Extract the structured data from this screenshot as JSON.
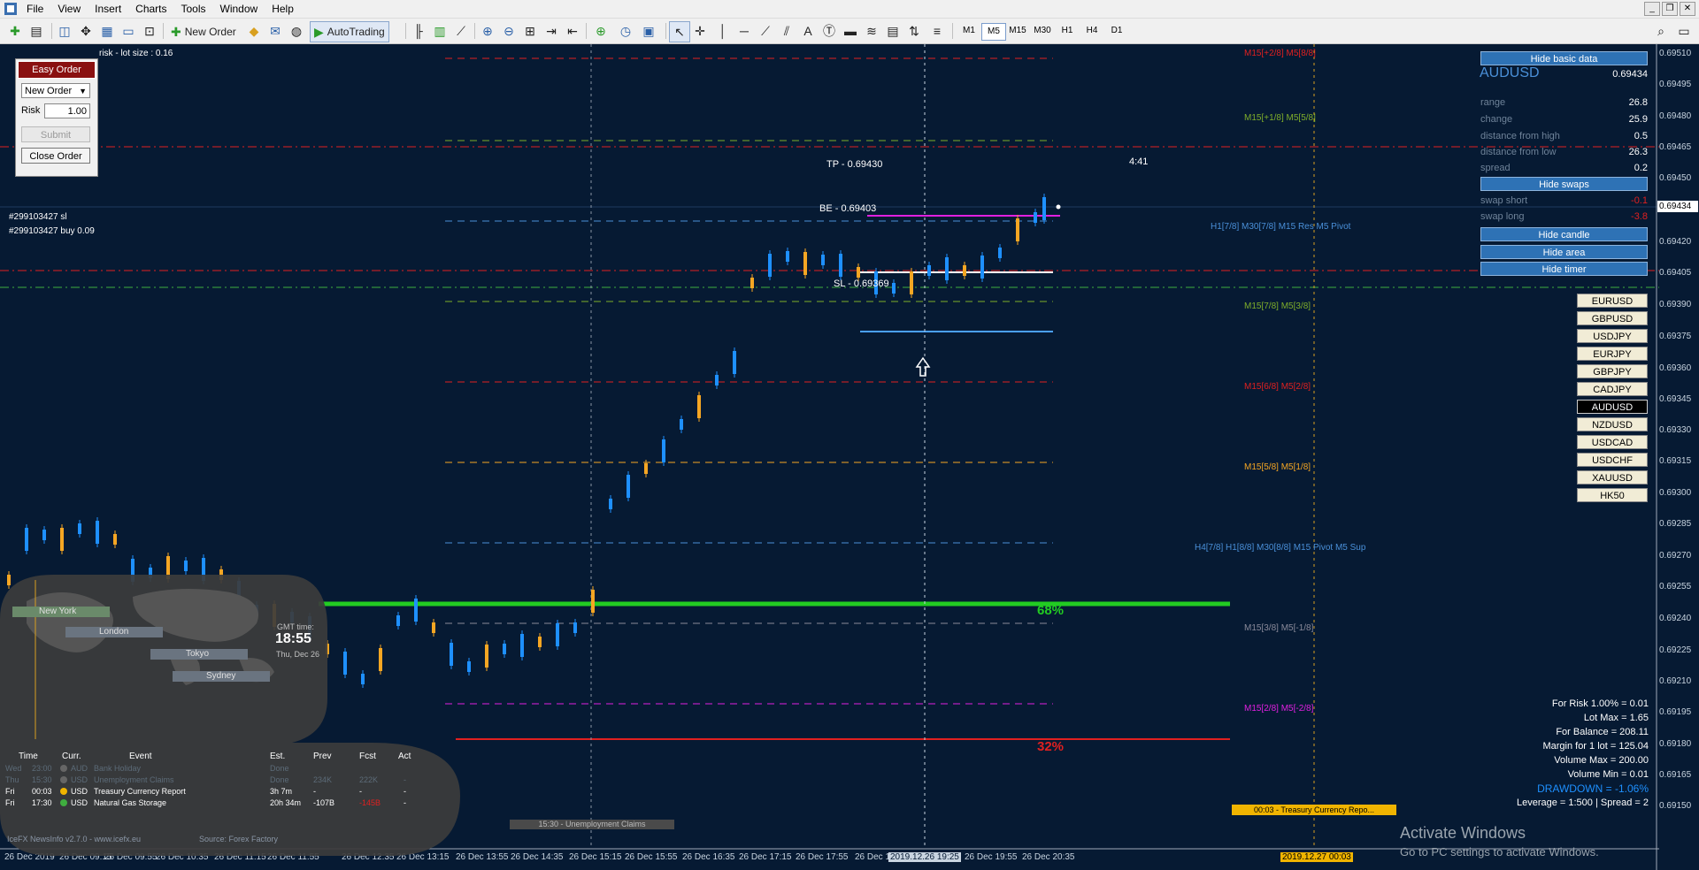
{
  "menubar": {
    "items": [
      "File",
      "View",
      "Insert",
      "Charts",
      "Tools",
      "Window",
      "Help"
    ]
  },
  "toolbar": {
    "new_order": "New Order",
    "autotrading": "AutoTrading",
    "timeframes": [
      "M1",
      "M5",
      "M15",
      "M30",
      "H1",
      "H4",
      "D1"
    ],
    "active_timeframe": "M5"
  },
  "easy_order": {
    "title": "Easy Order",
    "order_type": "New Order",
    "risk_label": "Risk",
    "risk_value": "1.00",
    "submit": "Submit",
    "close": "Close Order",
    "risk_info": "risk - lot size : 0.16"
  },
  "trade": {
    "sl_tag": "#299103427 sl",
    "buy_tag": "#299103427 buy 0.09",
    "tp": "TP - 0.69430",
    "be": "BE - 0.69403",
    "sl": "SL - 0.69369",
    "countdown": "4:41"
  },
  "levels": {
    "m15_p28": "M15[+2/8]  M5[8/8]",
    "m15_p18": "M15[+1/8]  M5[5/8]",
    "h1_res": "H1[7/8] M30[7/8] M15 Res   M5 Pivot",
    "m15_78": "M15[7/8]  M5[3/8]",
    "m15_68": "M15[6/8]  M5[2/8]",
    "m15_58": "M15[5/8]  M5[1/8]",
    "h4_sup": "H4[7/8] H1[8/8] M30[8/8] M15 Pivot   M5 Sup",
    "m15_38": "M15[3/8]  M5[-1/8]",
    "m15_28": "M15[2/8]  M5[-2/8]",
    "pct_68": "68%",
    "pct_32": "32%"
  },
  "basic_data": {
    "hide_basic": "Hide basic data",
    "symbol": "AUDUSD",
    "price": "0.69434",
    "stats": [
      {
        "label": "range",
        "value": "26.8"
      },
      {
        "label": "change",
        "value": "25.9"
      },
      {
        "label": "distance from high",
        "value": "0.5"
      },
      {
        "label": "distance from low",
        "value": "26.3"
      },
      {
        "label": "spread",
        "value": "0.2"
      }
    ],
    "hide_swaps": "Hide swaps",
    "swaps": [
      {
        "label": "swap short",
        "value": "-0.1"
      },
      {
        "label": "swap long",
        "value": "-3.8"
      }
    ],
    "hide_candle": "Hide candle",
    "hide_area": "Hide area",
    "hide_timer": "Hide timer"
  },
  "symbols": [
    "EURUSD",
    "GBPUSD",
    "USDJPY",
    "EURJPY",
    "GBPJPY",
    "CADJPY",
    "AUDUSD",
    "NZDUSD",
    "USDCAD",
    "USDCHF",
    "XAUUSD",
    "HK50"
  ],
  "active_symbol": "AUDUSD",
  "risk_info": [
    "For Risk 1.00% = 0.01",
    "Lot Max = 1.65",
    "For Balance = 208.11",
    "Margin for 1 lot = 125.04",
    "Volume Max = 200.00",
    "Volume Min = 0.01"
  ],
  "drawdown": "DRAWDOWN = -1.06%",
  "leverage": "Leverage = 1:500 | Spread = 2",
  "price_axis": [
    "0.69510",
    "0.69495",
    "0.69480",
    "0.69465",
    "0.69450",
    "0.69434",
    "0.69420",
    "0.69405",
    "0.69390",
    "0.69375",
    "0.69360",
    "0.69345",
    "0.69330",
    "0.69315",
    "0.69300",
    "0.69285",
    "0.69270",
    "0.69255",
    "0.69240",
    "0.69225",
    "0.69210",
    "0.69195",
    "0.69180",
    "0.69165",
    "0.69150"
  ],
  "time_axis": [
    "26 Dec 2019",
    "26 Dec 09:15",
    "26 Dec 09:55",
    "26 Dec 10:35",
    "26 Dec 11:15",
    "26 Dec 11:55",
    "26 Dec 12:35",
    "26 Dec 13:15",
    "26 Dec 13:55",
    "26 Dec 14:35",
    "26 Dec 15:15",
    "26 Dec 15:55",
    "26 Dec 16:35",
    "26 Dec 17:15",
    "26 Dec 17:55",
    "26 Dec 18:",
    "2019.12.26 19:25",
    "26 Dec 19:55",
    "26 Dec 20:35",
    "2019.12.27 00:03"
  ],
  "world_clock": {
    "cities": [
      "New York",
      "London",
      "Tokyo",
      "Sydney"
    ],
    "gmt_label": "GMT time:",
    "gmt_time": "18:55",
    "gmt_date": "Thu, Dec 26"
  },
  "news": {
    "headers": [
      "Time",
      "Curr.",
      "Event",
      "Est.",
      "Prev",
      "Fcst",
      "Act"
    ],
    "rows": [
      {
        "day": "Wed",
        "time": "23:00",
        "curr": "AUD",
        "event": "Bank Holiday",
        "est": "Done",
        "prev": "",
        "fcst": "",
        "act": ""
      },
      {
        "day": "Thu",
        "time": "15:30",
        "curr": "USD",
        "event": "Unemployment Claims",
        "est": "Done",
        "prev": "234K",
        "fcst": "222K",
        "act": "-"
      },
      {
        "day": "Fri",
        "time": "00:03",
        "curr": "USD",
        "event": "Treasury Currency Report",
        "est": "3h 7m",
        "prev": "-",
        "fcst": "-",
        "act": "-"
      },
      {
        "day": "Fri",
        "time": "17:30",
        "curr": "USD",
        "event": "Natural Gas Storage",
        "est": "20h 34m",
        "prev": "-107B",
        "fcst": "-145B",
        "act": "-"
      }
    ],
    "footer": "IceFX NewsInfo v2.7.0  -  www.icefx.eu",
    "source": "Source: Forex Factory",
    "event_marker": "15:30 - Unemployment Claims",
    "upcoming_marker": "00:03 - Treasury Currency Repo..."
  },
  "activate": {
    "title": "Activate Windows",
    "sub": "Go to PC settings to activate Windows."
  },
  "colors": {
    "chart_bg": "#061a33",
    "bull": "#1e90ff",
    "bear": "#f5a623",
    "green": "#22cc22",
    "red": "#e02020",
    "magenta": "#e020e0"
  }
}
